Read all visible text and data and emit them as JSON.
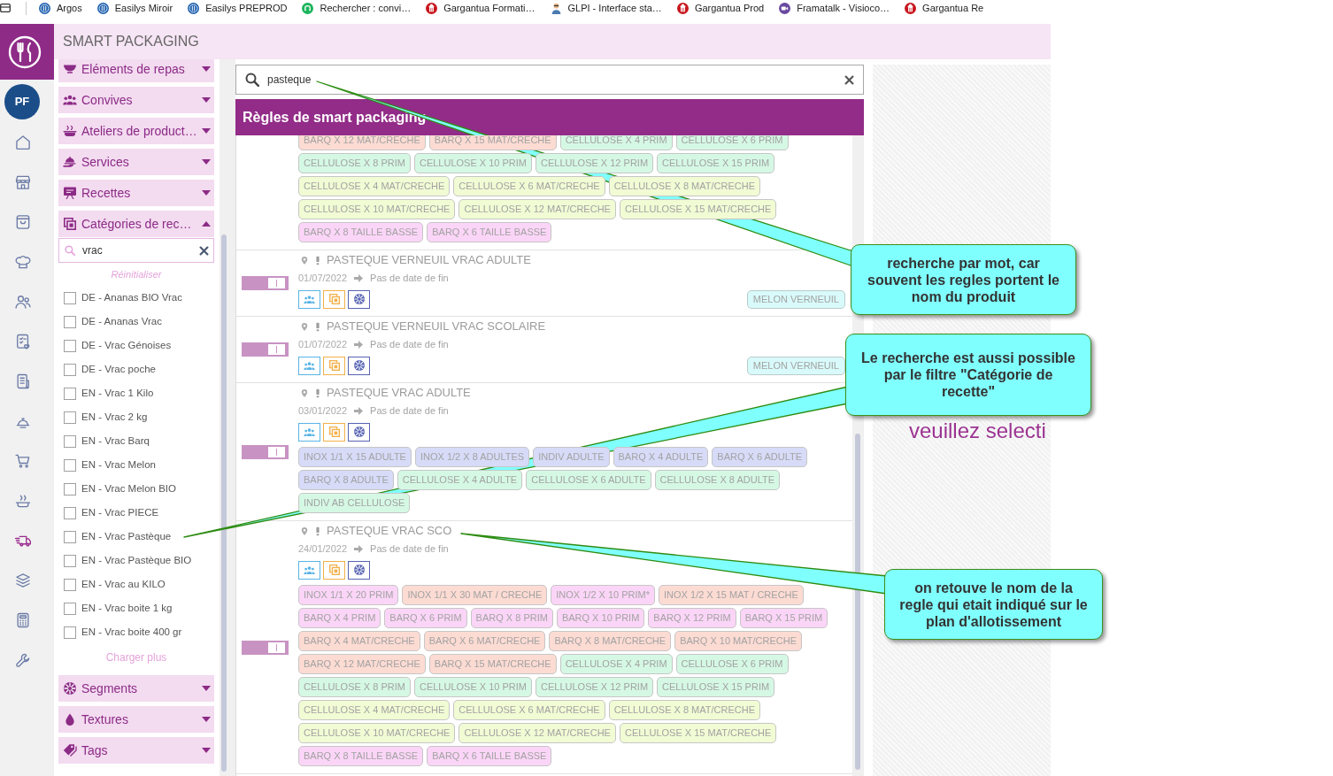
{
  "bookmarks": [
    "Argos",
    "Easilys Miroir",
    "Easilys PREPROD",
    "Rechercher : convi…",
    "Gargantua Formati…",
    "GLPI - Interface sta…",
    "Gargantua Prod",
    "Framatalk - Visioco…",
    "Gargantua Re"
  ],
  "app": {
    "title": "SMART PACKAGING",
    "user_initials": "PF"
  },
  "nav": [
    {
      "selected": false
    },
    {
      "selected": false
    },
    {
      "selected": false
    },
    {
      "selected": false
    },
    {
      "selected": false
    },
    {
      "selected": false
    },
    {
      "selected": false
    },
    {
      "selected": false
    },
    {
      "selected": false
    },
    {
      "selected": false
    },
    {
      "selected": true
    },
    {
      "selected": false
    },
    {
      "selected": false
    },
    {
      "selected": false
    }
  ],
  "filters": [
    {
      "label": "Eléments de repas",
      "expanded": false
    },
    {
      "label": "Convives",
      "expanded": false
    },
    {
      "label": "Ateliers de product…",
      "expanded": false
    },
    {
      "label": "Services",
      "expanded": false
    },
    {
      "label": "Recettes",
      "expanded": false
    },
    {
      "label": "Catégories de rec…",
      "expanded": true,
      "search": {
        "value": "vrac"
      },
      "reset": "Réinitialiser",
      "options": [
        {
          "label": "DE - Ananas BIO Vrac",
          "checked": false
        },
        {
          "label": "DE - Ananas Vrac",
          "checked": false
        },
        {
          "label": "DE - Vrac Génoises",
          "checked": false
        },
        {
          "label": "DE - Vrac poche",
          "checked": false
        },
        {
          "label": "EN - Vrac 1 Kilo",
          "checked": false
        },
        {
          "label": "EN - Vrac 2 kg",
          "checked": false
        },
        {
          "label": "EN - Vrac Barq",
          "checked": false
        },
        {
          "label": "EN - Vrac Melon",
          "checked": false
        },
        {
          "label": "EN - Vrac Melon BIO",
          "checked": false
        },
        {
          "label": "EN - Vrac PIECE",
          "checked": false
        },
        {
          "label": "EN - Vrac Pastèque",
          "checked": false
        },
        {
          "label": "EN - Vrac Pastèque BIO",
          "checked": false
        },
        {
          "label": "EN - Vrac au KILO",
          "checked": false
        },
        {
          "label": "EN - Vrac boite 1 kg",
          "checked": false
        },
        {
          "label": "EN - Vrac boite 400 gr",
          "checked": false
        }
      ],
      "more": "Charger plus"
    },
    {
      "label": "Segments",
      "expanded": false
    },
    {
      "label": "Textures",
      "expanded": false
    },
    {
      "label": "Tags",
      "expanded": false
    }
  ],
  "search": {
    "value": "pasteque"
  },
  "panel_title": "Règles de smart packaging",
  "rules": [
    {
      "tags": [
        {
          "label": "BARQ X 12 MAT/CRECHE",
          "color": "#fcdbd3"
        },
        {
          "label": "BARQ X 15 MAT/CRECHE",
          "color": "#fcdbd3"
        },
        {
          "label": "CELLULOSE X 4 PRIM",
          "color": "#d5f8e4"
        },
        {
          "label": "CELLULOSE X 6 PRIM",
          "color": "#d5f8e4"
        },
        {
          "label": "CELLULOSE X 8 PRIM",
          "color": "#d5f8e4"
        },
        {
          "label": "CELLULOSE X 10 PRIM",
          "color": "#d5f8e4"
        },
        {
          "label": "CELLULOSE X 12 PRIM",
          "color": "#d5f8e4"
        },
        {
          "label": "CELLULOSE X 15 PRIM",
          "color": "#d5f8e4"
        },
        {
          "label": "CELLULOSE X 4 MAT/CRECHE",
          "color": "#f1fbd4"
        },
        {
          "label": "CELLULOSE X 6 MAT/CRECHE",
          "color": "#f1fbd4"
        },
        {
          "label": "CELLULOSE X 8 MAT/CRECHE",
          "color": "#f1fbd4"
        },
        {
          "label": "CELLULOSE X 10 MAT/CRECHE",
          "color": "#f1fbd4"
        },
        {
          "label": "CELLULOSE X 12 MAT/CRECHE",
          "color": "#f1fbd4"
        },
        {
          "label": "CELLULOSE X 15 MAT/CRECHE",
          "color": "#f1fbd4"
        },
        {
          "label": "BARQ X 8 TAILLE BASSE",
          "color": "#fbd5f7"
        },
        {
          "label": "BARQ X 6 TAILLE BASSE",
          "color": "#fbd5f7"
        }
      ]
    },
    {
      "title": "PASTEQUE VERNEUIL VRAC ADULTE",
      "active": true,
      "start": "01/07/2022",
      "end": "Pas de date de fin",
      "badge": "MELON VERNEUIL"
    },
    {
      "title": "PASTEQUE VERNEUIL VRAC SCOLAIRE",
      "active": true,
      "start": "01/07/2022",
      "end": "Pas de date de fin",
      "badge": "MELON VERNEUIL"
    },
    {
      "title": "PASTEQUE VRAC ADULTE",
      "active": true,
      "start": "03/01/2022",
      "end": "Pas de date de fin",
      "tags": [
        {
          "label": "INOX 1/1 X 15 ADULTE",
          "color": "#d7dbf8"
        },
        {
          "label": "INOX 1/2 X 8 ADULTES",
          "color": "#d7dbf8"
        },
        {
          "label": "INDIV ADULTE",
          "color": "#d7dbf8"
        },
        {
          "label": "BARQ X 4 ADULTE",
          "color": "#d7dbf8"
        },
        {
          "label": "BARQ X 6 ADULTE",
          "color": "#d7dbf8"
        },
        {
          "label": "BARQ X 8 ADULTE",
          "color": "#d7dbf8"
        },
        {
          "label": "CELLULOSE X 4 ADULTE",
          "color": "#d5f8e4"
        },
        {
          "label": "CELLULOSE X 6 ADULTE",
          "color": "#d5f8e4"
        },
        {
          "label": "CELLULOSE X 8 ADULTE",
          "color": "#d5f8e4"
        },
        {
          "label": "INDIV AB CELLULOSE",
          "color": "#d5f8e4"
        }
      ]
    },
    {
      "title": "PASTEQUE VRAC SCO",
      "active": true,
      "start": "24/01/2022",
      "end": "Pas de date de fin",
      "tags": [
        {
          "label": "INOX 1/1 X 20 PRIM",
          "color": "#fbd5f7"
        },
        {
          "label": "INOX 1/1 X 30 MAT / CRECHE",
          "color": "#fcdbd3"
        },
        {
          "label": "INOX 1/2 X 10 PRIM*",
          "color": "#fbd5f7"
        },
        {
          "label": "INOX 1/2 X 15 MAT / CRECHE",
          "color": "#fcdbd3"
        },
        {
          "label": "BARQ X 4 PRIM",
          "color": "#fbd5f7"
        },
        {
          "label": "BARQ X 6 PRIM",
          "color": "#fbd5f7"
        },
        {
          "label": "BARQ X 8 PRIM",
          "color": "#fbd5f7"
        },
        {
          "label": "BARQ X 10 PRIM",
          "color": "#fbd5f7"
        },
        {
          "label": "BARQ X 12 PRIM",
          "color": "#fbd5f7"
        },
        {
          "label": "BARQ X 15 PRIM",
          "color": "#fbd5f7"
        },
        {
          "label": "BARQ X 4 MAT/CRECHE",
          "color": "#fcdbd3"
        },
        {
          "label": "BARQ X 6 MAT/CRECHE",
          "color": "#fcdbd3"
        },
        {
          "label": "BARQ X 8 MAT/CRECHE",
          "color": "#fcdbd3"
        },
        {
          "label": "BARQ X 10 MAT/CRECHE",
          "color": "#fcdbd3"
        },
        {
          "label": "BARQ X 12 MAT/CRECHE",
          "color": "#fcdbd3"
        },
        {
          "label": "BARQ X 15 MAT/CRECHE",
          "color": "#fcdbd3"
        },
        {
          "label": "CELLULOSE X 4 PRIM",
          "color": "#d5f8e4"
        },
        {
          "label": "CELLULOSE X 6 PRIM",
          "color": "#d5f8e4"
        },
        {
          "label": "CELLULOSE X 8 PRIM",
          "color": "#d5f8e4"
        },
        {
          "label": "CELLULOSE X 10 PRIM",
          "color": "#d5f8e4"
        },
        {
          "label": "CELLULOSE X 12 PRIM",
          "color": "#d5f8e4"
        },
        {
          "label": "CELLULOSE X 15 PRIM",
          "color": "#d5f8e4"
        },
        {
          "label": "CELLULOSE X 4 MAT/CRECHE",
          "color": "#f1fbd4"
        },
        {
          "label": "CELLULOSE X 6 MAT/CRECHE",
          "color": "#f1fbd4"
        },
        {
          "label": "CELLULOSE X 8 MAT/CRECHE",
          "color": "#f1fbd4"
        },
        {
          "label": "CELLULOSE X 10 MAT/CRECHE",
          "color": "#f1fbd4"
        },
        {
          "label": "CELLULOSE X 12 MAT/CRECHE",
          "color": "#f1fbd4"
        },
        {
          "label": "CELLULOSE X 15 MAT/CRECHE",
          "color": "#f1fbd4"
        },
        {
          "label": "BARQ X 8 TAILLE BASSE",
          "color": "#fbd5f7"
        },
        {
          "label": "BARQ X 6 TAILLE BASSE",
          "color": "#fbd5f7"
        }
      ]
    }
  ],
  "detail": {
    "message": "veuillez selecti"
  },
  "annotations": [
    {
      "text": "recherche par mot, car souvent les regles portent le nom du produit"
    },
    {
      "text": "Le recherche est aussi possible par le filtre \"Catégorie de recette\""
    },
    {
      "text": "on retouve le nom de la regle qui etait indiqué sur le plan d'allotissement"
    }
  ]
}
